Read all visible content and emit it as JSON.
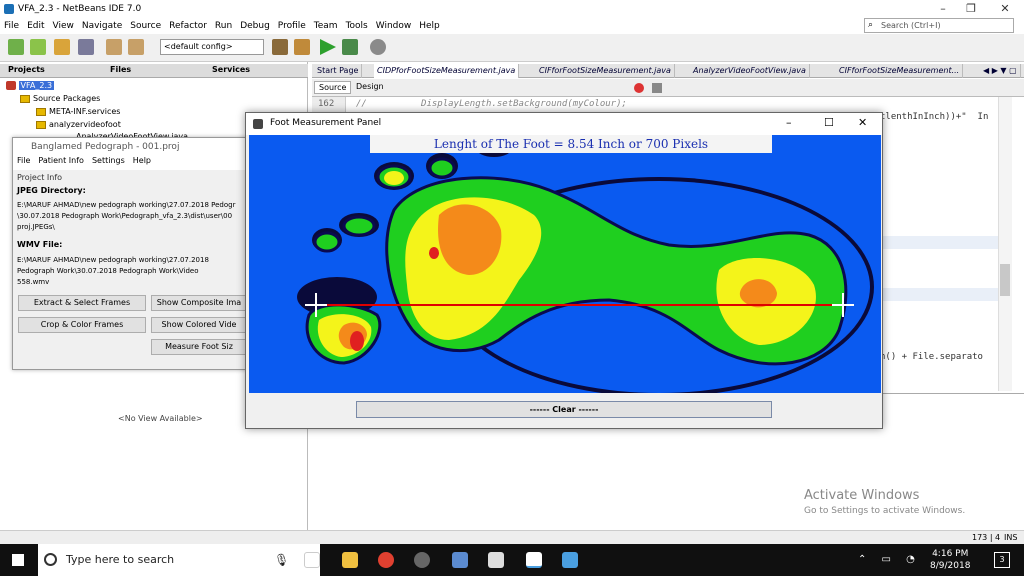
{
  "ide": {
    "title": "VFA_2.3 - NetBeans IDE 7.0",
    "menu": [
      "File",
      "Edit",
      "View",
      "Navigate",
      "Source",
      "Refactor",
      "Run",
      "Debug",
      "Profile",
      "Team",
      "Tools",
      "Window",
      "Help"
    ],
    "search_placeholder": "Search (Ctrl+I)",
    "config": "<default config>"
  },
  "left_tabs": {
    "projects": "Projects",
    "files": "Files",
    "services": "Services"
  },
  "tree": {
    "project": "VFA_2.3",
    "source_packages": "Source Packages",
    "meta": "META-INF.services",
    "pkg": "analyzervideofoot",
    "partial_file": "AnalyzerVideoFootView.java"
  },
  "no_view": "<No View Available>",
  "editor_tabs": [
    "Start Page",
    "CIDPforFootSizeMeasurement.java",
    "CIFforFootSizeMeasurement.java",
    "AnalyzerVideoFootView.java",
    "CIFforFootSizeMeasurement..."
  ],
  "source_tab": "Source",
  "design_tab": "Design",
  "line_number": "162",
  "code_line_1": "//          DisplayLength.setBackground(myColour);",
  "code_line_2": "tlenthInInch))+\"  In",
  "code_line_3": "h() + File.separato",
  "pedograph": {
    "title": "Banglamed Pedograph - 001.proj",
    "menu": [
      "File",
      "Patient Info",
      "Settings",
      "Help"
    ],
    "section": "Project Info",
    "jpeg_label": "JPEG Directory:",
    "jpeg_path_1": "E:\\MARUF AHMAD\\new pedograph working\\27.07.2018 Pedogr",
    "jpeg_path_2": "\\30.07.2018 Pedograph Work\\Pedograph_vfa_2.3\\dist\\user\\00",
    "jpeg_path_3": "proj.JPEGs\\",
    "wmv_label": "WMV File:",
    "wmv_path_1": "E:\\MARUF AHMAD\\new pedograph working\\27.07.2018",
    "wmv_path_2": "Pedograph Work\\30.07.2018 Pedograph Work\\Video",
    "wmv_path_3": "558.wmv",
    "btn_extract": "Extract & Select Frames",
    "btn_composite": "Show Composite Ima",
    "btn_crop": "Crop & Color Frames",
    "btn_colored": "Show Colored Vide",
    "btn_measure": "Measure Foot Siz"
  },
  "foot_panel": {
    "title": "Foot Measurement Panel",
    "length_text": "Lenght of The Foot = 8.54 Inch or 700 Pixels",
    "clear": "------ Clear ------"
  },
  "watermark": {
    "line1": "Activate Windows",
    "line2": "Go to Settings to activate Windows."
  },
  "status": {
    "position": "173 | 4",
    "mode": "INS"
  },
  "taskbar": {
    "search": "Type here to search",
    "time": "4:16 PM",
    "date": "8/9/2018",
    "notifications": "3"
  }
}
